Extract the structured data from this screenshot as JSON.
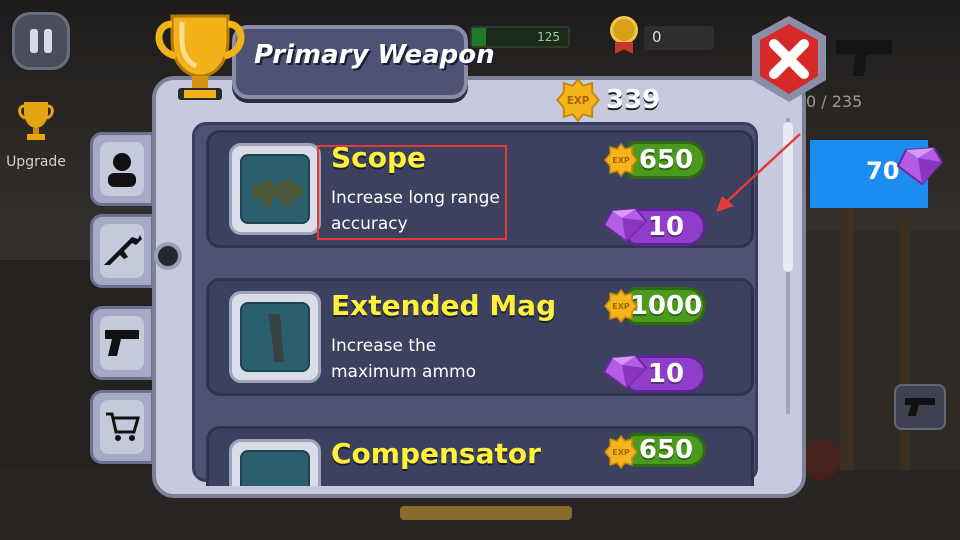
{
  "dialog": {
    "title": "Primary Weapon",
    "xp_total": "339"
  },
  "hud": {
    "health_text": "125",
    "medal_count": "0",
    "ammo_text": "0 / 235",
    "gems": "70",
    "upgrade_label": "Upgrade"
  },
  "badges": {
    "xp_label": "EXP"
  },
  "upgrades": [
    {
      "name": "Scope",
      "description": "Increase long range accuracy",
      "xp_price": "650",
      "gem_price": "10"
    },
    {
      "name": "Extended Mag",
      "description": "Increase the maximum ammo",
      "xp_price": "1000",
      "gem_price": "10"
    },
    {
      "name": "Compensator",
      "description": "",
      "xp_price": "650",
      "gem_price": ""
    }
  ],
  "side_tabs": [
    "character-icon",
    "rifle-icon",
    "pistol-icon",
    "cart-icon"
  ],
  "colors": {
    "dialog_frame": "#c7cade",
    "card_bg": "#3c4160",
    "title_yellow": "#fff13a",
    "xp_green": "#4a9a1e",
    "gem_purple": "#8e3ec8",
    "close_red": "#d62a2a",
    "highlight_red": "#e43b3b"
  }
}
